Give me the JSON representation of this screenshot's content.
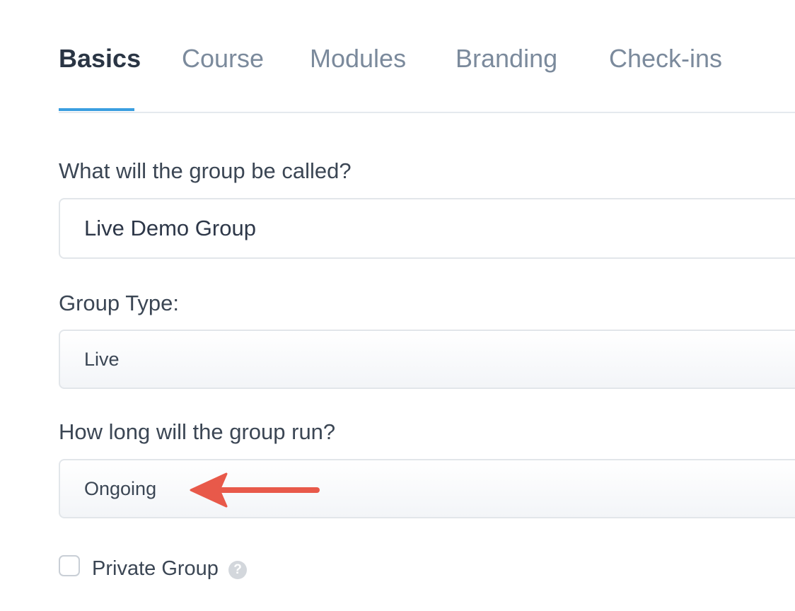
{
  "tabs": [
    {
      "label": "Basics",
      "active": true
    },
    {
      "label": "Course",
      "active": false
    },
    {
      "label": "Modules",
      "active": false
    },
    {
      "label": "Branding",
      "active": false
    },
    {
      "label": "Check-ins",
      "active": false
    }
  ],
  "form": {
    "name_label": "What will the group be called?",
    "name_value": "Live Demo Group",
    "type_label": "Group Type:",
    "type_value": "Live",
    "duration_label": "How long will the group run?",
    "duration_value": "Ongoing",
    "private_label": "Private Group",
    "private_checked": false,
    "help_glyph": "?"
  },
  "icons": {
    "help": "question-circle-icon",
    "annotation": "red-arrow-left"
  },
  "colors": {
    "accent": "#3a9ee0",
    "annotation": "#e8594a",
    "tab_inactive": "#7b8a9c",
    "tab_active": "#2a3544"
  }
}
